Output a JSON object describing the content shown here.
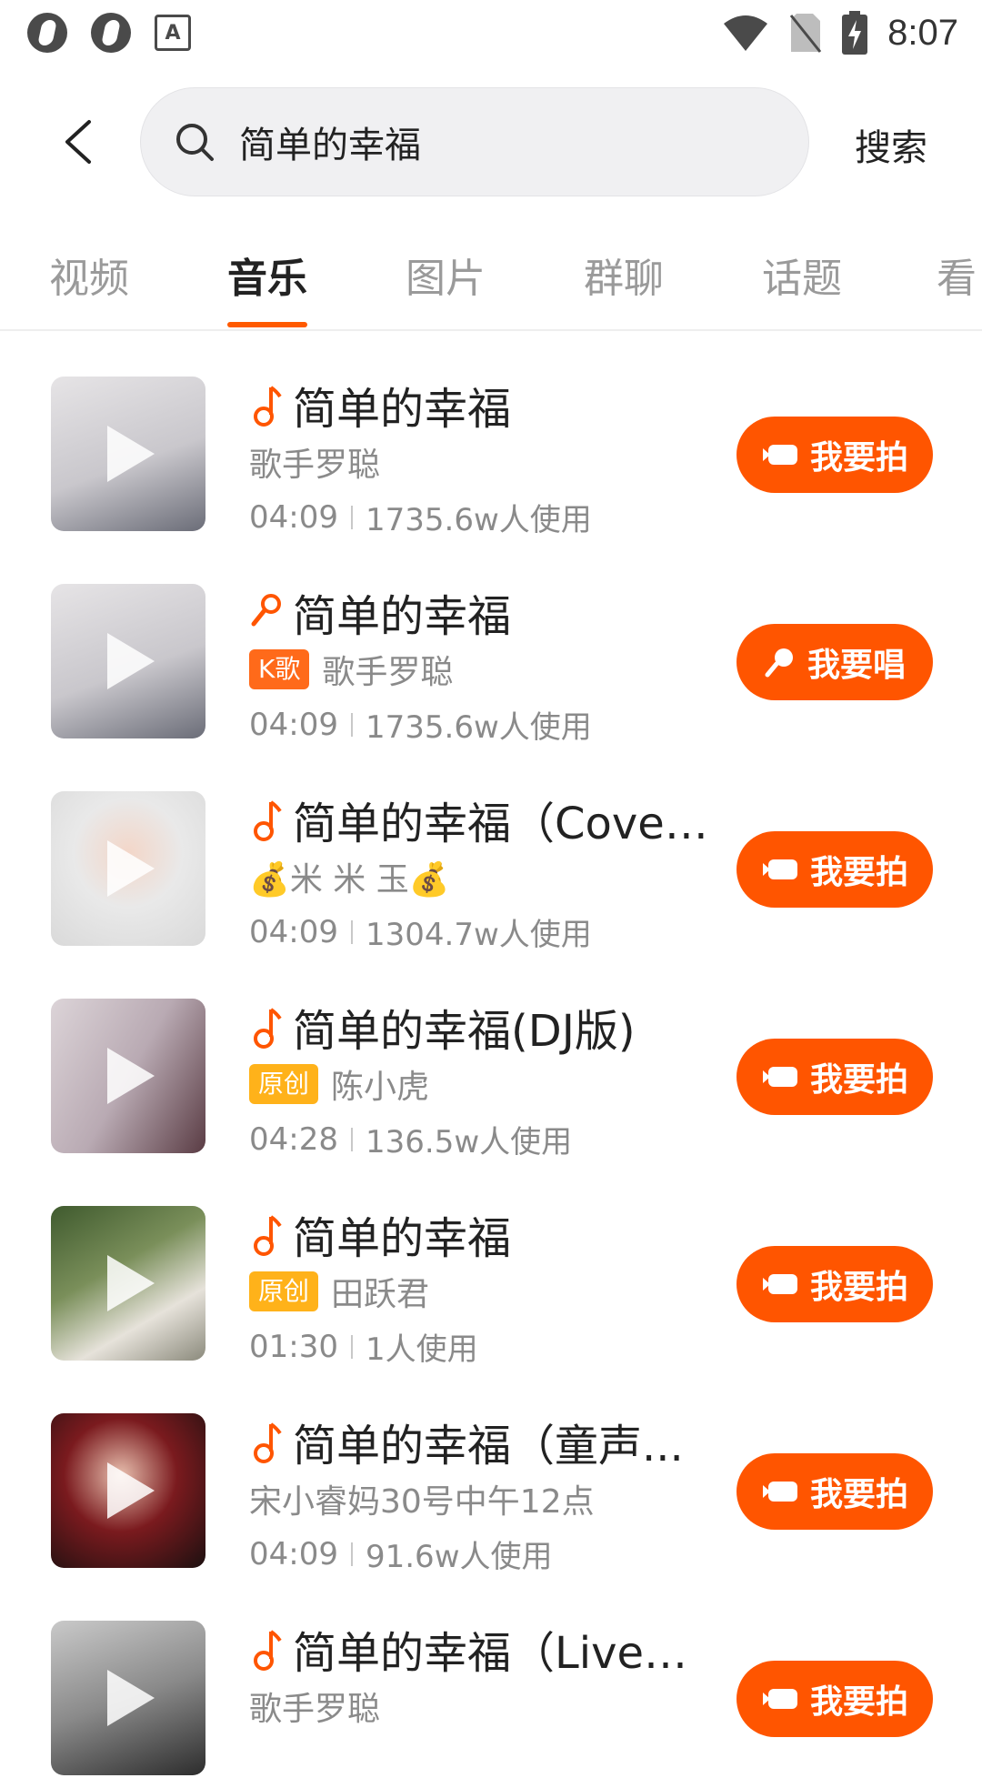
{
  "status_bar": {
    "time": "8:07"
  },
  "search": {
    "query": "简单的幸福",
    "button_label": "搜索"
  },
  "tabs": [
    {
      "label": "视频"
    },
    {
      "label": "音乐"
    },
    {
      "label": "图片"
    },
    {
      "label": "群聊"
    },
    {
      "label": "话题"
    },
    {
      "label": "看"
    }
  ],
  "active_tab": "音乐",
  "colors": {
    "accent": "#ff5500",
    "tag_k": "#ff6a1a",
    "tag_original": "#ffb21a"
  },
  "songs": [
    {
      "title": "简单的幸福",
      "artist": "歌手罗聪",
      "tag": "",
      "duration": "04:09",
      "usage": "1735.6w人使用",
      "action": "我要拍",
      "icon": "music-note-icon"
    },
    {
      "title": "简单的幸福",
      "artist": "歌手罗聪",
      "tag": "K歌",
      "duration": "04:09",
      "usage": "1735.6w人使用",
      "action": "我要唱",
      "icon": "microphone-icon"
    },
    {
      "title": "简单的幸福（Cover ...",
      "artist": "💰米 米 玉💰",
      "tag": "",
      "duration": "04:09",
      "usage": "1304.7w人使用",
      "action": "我要拍",
      "icon": "music-note-icon"
    },
    {
      "title": "简单的幸福(DJ版)",
      "artist": "陈小虎",
      "tag": "原创",
      "duration": "04:28",
      "usage": "136.5w人使用",
      "action": "我要拍",
      "icon": "music-note-icon"
    },
    {
      "title": "简单的幸福",
      "artist": "田跃君",
      "tag": "原创",
      "duration": "01:30",
      "usage": "1人使用",
      "action": "我要拍",
      "icon": "music-note-icon"
    },
    {
      "title": "简单的幸福（童声...",
      "artist": "宋小睿妈30号中午12点",
      "tag": "",
      "duration": "04:09",
      "usage": "91.6w人使用",
      "action": "我要拍",
      "icon": "music-note-icon"
    },
    {
      "title": "简单的幸福（Live版...",
      "artist": "歌手罗聪",
      "tag": "",
      "duration": "",
      "usage": "",
      "action": "我要拍",
      "icon": "music-note-icon"
    }
  ]
}
